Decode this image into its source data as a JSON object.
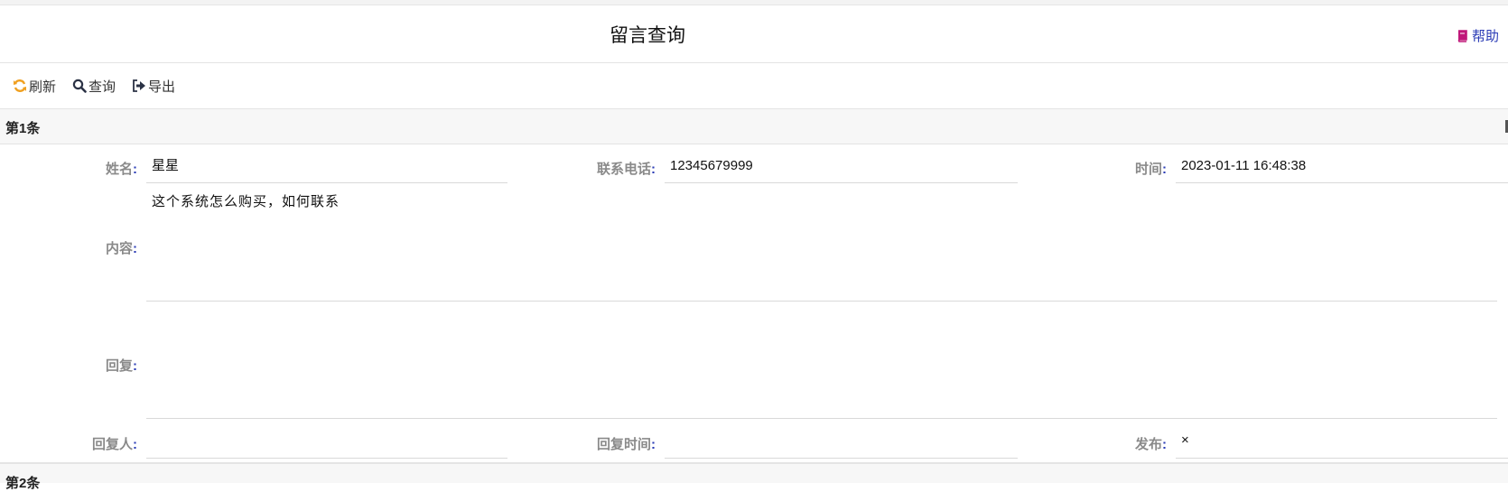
{
  "header": {
    "title": "留言查询",
    "help_label": "帮助"
  },
  "toolbar": {
    "refresh_label": "刷新",
    "query_label": "查询",
    "export_label": "导出"
  },
  "records": [
    {
      "heading": "第1条",
      "name_label": "姓名",
      "name_value": "星星",
      "phone_label": "联系电话",
      "phone_value": "12345679999",
      "time_label": "时间",
      "time_value": "2023-01-11 16:48:38",
      "content_label": "内容",
      "content_value": "这个系统怎么购买，如何联系",
      "reply_label": "回复",
      "reply_value": "",
      "replier_label": "回复人",
      "replier_value": "",
      "reply_time_label": "回复时间",
      "reply_time_value": "",
      "publish_label": "发布",
      "publish_value": "×"
    },
    {
      "heading": "第2条"
    }
  ],
  "colors": {
    "accent_blue": "#2a3bb5",
    "refresh_orange": "#f0a020",
    "help_book_magenta": "#c0187a"
  }
}
